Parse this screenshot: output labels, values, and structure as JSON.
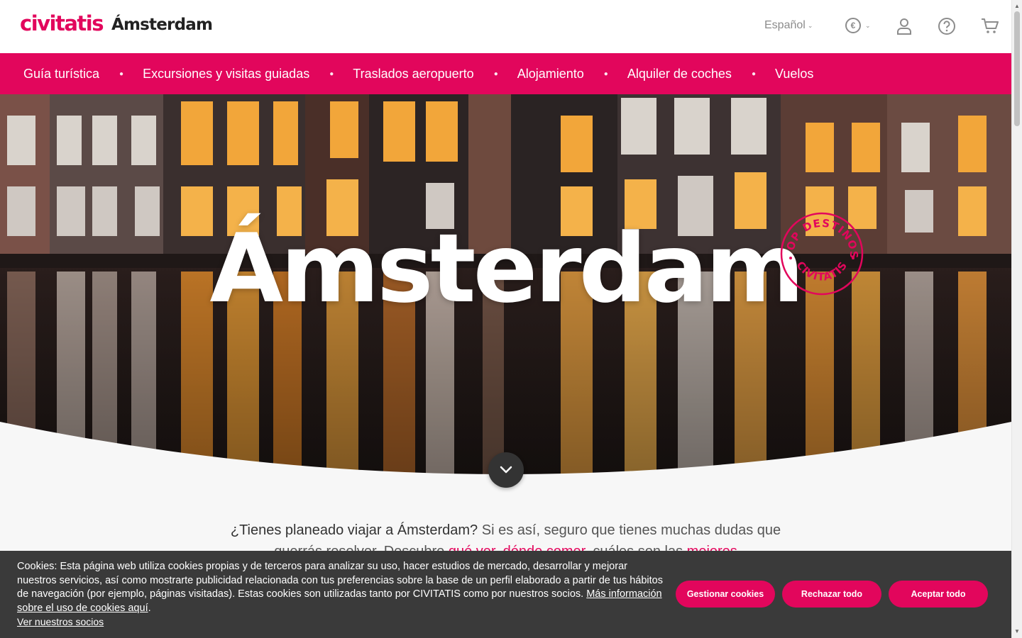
{
  "header": {
    "brand": "civitatis",
    "city": "Ámsterdam",
    "language": "Español",
    "currency_symbol": "€",
    "icons": [
      "chevron-down-icon",
      "euro-icon",
      "user-icon",
      "help-icon",
      "cart-icon"
    ]
  },
  "nav": {
    "items": [
      {
        "label": "Guía turística"
      },
      {
        "label": "Excursiones y visitas guiadas"
      },
      {
        "label": "Traslados aeropuerto"
      },
      {
        "label": "Alojamiento"
      },
      {
        "label": "Alquiler de coches"
      },
      {
        "label": "Vuelos"
      }
    ]
  },
  "hero": {
    "title": "Ámsterdam",
    "badge_top": "TOP DESTINOS",
    "badge_bottom": "CIVITATIS"
  },
  "intro": {
    "lead": "¿Tienes planeado viajar a Ámsterdam?",
    "text": " Si es así, seguro que tienes muchas dudas que querrás resolver. Descubre ",
    "link1": "qué ver",
    "sep": ", ",
    "link2": "dónde comer",
    "text2": ", cuáles son las ",
    "link3": "mejores"
  },
  "cookies": {
    "text": "Cookies: Esta página web utiliza cookies propias y de terceros para analizar su uso, hacer estudios de mercado, desarrollar y mejorar nuestros servicios, así como mostrarte publicidad relacionada con tus preferencias sobre la base de un perfil elaborado a partir de tus hábitos de navegación (por ejemplo, páginas visitadas). Estas cookies son utilizadas tanto por CIVITATIS como por nuestros socios. ",
    "more_link": "Más información sobre el uso de cookies aquí",
    "period": ".",
    "partners_link": "Ver nuestros socios",
    "buttons": {
      "manage": "Gestionar cookies",
      "reject": "Rechazar todo",
      "accept": "Aceptar todo"
    }
  },
  "colors": {
    "brand": "#e2065c",
    "dark": "#3a3a3a"
  }
}
